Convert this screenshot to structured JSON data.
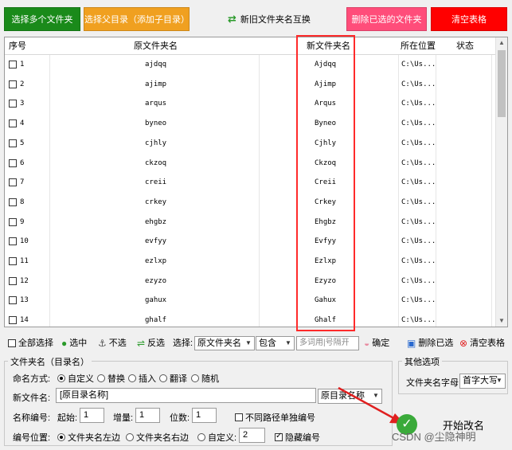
{
  "top_buttons": {
    "select_multi": "选择多个文件夹",
    "select_parent": "选择父目录（添加子目录）",
    "swap": "新旧文件夹名互换",
    "delete_selected": "删除已选的文件夹",
    "clear_table": "清空表格"
  },
  "colors": {
    "green": "#1a8a1a",
    "orange": "#f0a020",
    "pink": "#ff4d7a",
    "red": "#ff0000",
    "highlight": "#ff2a2a"
  },
  "table": {
    "headers": [
      "序号",
      "原文件夹名",
      "新文件夹名",
      "所在位置",
      "状态"
    ],
    "rows": [
      {
        "n": "1",
        "old": "ajdqq",
        "new": "Ajdqq",
        "loc": "C:\\Us..."
      },
      {
        "n": "2",
        "old": "ajimp",
        "new": "Ajimp",
        "loc": "C:\\Us..."
      },
      {
        "n": "3",
        "old": "arqus",
        "new": "Arqus",
        "loc": "C:\\Us..."
      },
      {
        "n": "4",
        "old": "byneo",
        "new": "Byneo",
        "loc": "C:\\Us..."
      },
      {
        "n": "5",
        "old": "cjhly",
        "new": "Cjhly",
        "loc": "C:\\Us..."
      },
      {
        "n": "6",
        "old": "ckzoq",
        "new": "Ckzoq",
        "loc": "C:\\Us..."
      },
      {
        "n": "7",
        "old": "creii",
        "new": "Creii",
        "loc": "C:\\Us..."
      },
      {
        "n": "8",
        "old": "crkey",
        "new": "Crkey",
        "loc": "C:\\Us..."
      },
      {
        "n": "9",
        "old": "ehgbz",
        "new": "Ehgbz",
        "loc": "C:\\Us..."
      },
      {
        "n": "10",
        "old": "evfyy",
        "new": "Evfyy",
        "loc": "C:\\Us..."
      },
      {
        "n": "11",
        "old": "ezlxp",
        "new": "Ezlxp",
        "loc": "C:\\Us..."
      },
      {
        "n": "12",
        "old": "ezyzo",
        "new": "Ezyzo",
        "loc": "C:\\Us..."
      },
      {
        "n": "13",
        "old": "gahux",
        "new": "Gahux",
        "loc": "C:\\Us..."
      },
      {
        "n": "14",
        "old": "ghalf",
        "new": "Ghalf",
        "loc": "C:\\Us..."
      }
    ]
  },
  "toolbar": {
    "select_all": "全部选择",
    "select": "选中",
    "unselect": "不选",
    "invert": "反选",
    "choose_label": "选择:",
    "field_value": "原文件夹名",
    "match_value": "包含",
    "keyword_placeholder": "多词用|号隔开",
    "confirm": "确定",
    "delete_selected": "删除已选",
    "clear_table": "清空表格"
  },
  "name_group": {
    "title": "文件夹名（目录名）",
    "naming_mode_label": "命名方式:",
    "modes": [
      "自定义",
      "替换",
      "插入",
      "翻译",
      "随机"
    ],
    "new_name_label": "新文件名:",
    "new_name_value": "[原目录名称]",
    "new_name_dropdown": "原目录名称",
    "numbering_label": "名称编号:",
    "start_label": "起始:",
    "start_value": "1",
    "step_label": "增量:",
    "step_value": "1",
    "digits_label": "位数:",
    "digits_value": "1",
    "separate_paths": "不同路径单独编号",
    "position_label": "编号位置:",
    "positions": [
      "文件夹名左边",
      "文件夹名右边",
      "自定义:"
    ],
    "custom_pos_value": "2",
    "hide_number": "隐藏编号"
  },
  "other_group": {
    "title": "其他选项",
    "case_label": "文件夹名字母:",
    "case_value": "首字大写"
  },
  "start_label": "开始改名",
  "watermark": "CSDN @尘隐神明"
}
